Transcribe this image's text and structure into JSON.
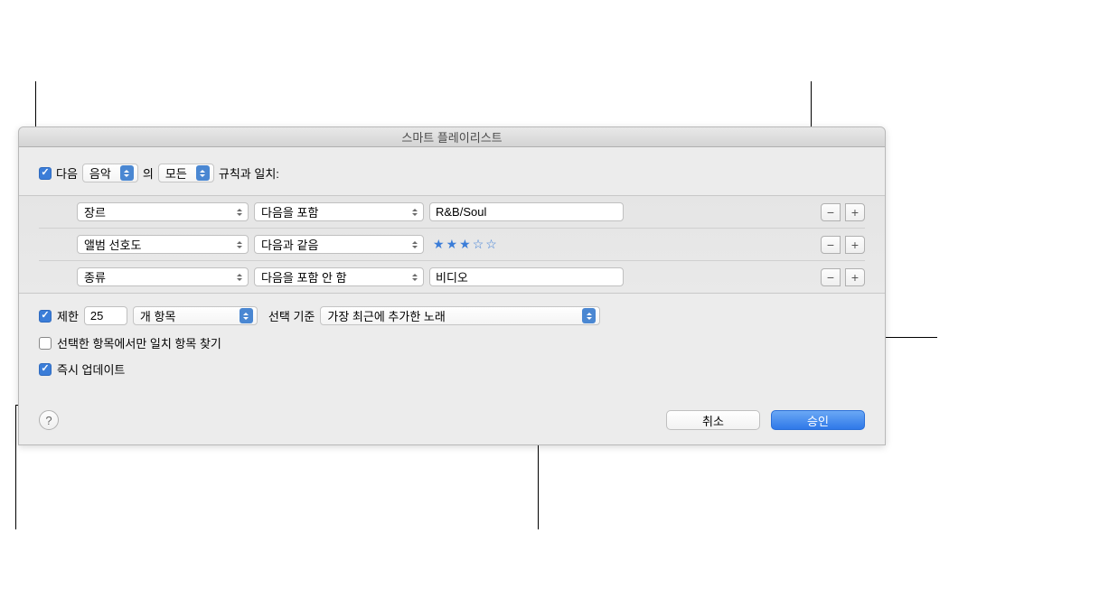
{
  "title": "스마트 플레이리스트",
  "match": {
    "prefix": "다음",
    "media": "음악",
    "joiner": "의",
    "mode": "모든",
    "suffix": "규칙과 일치:"
  },
  "rules": [
    {
      "field": "장르",
      "operator": "다음을 포함",
      "value": "R&B/Soul",
      "type": "text"
    },
    {
      "field": "앨범 선호도",
      "operator": "다음과 같음",
      "value": "3",
      "type": "stars"
    },
    {
      "field": "종류",
      "operator": "다음을 포함 안 함",
      "value": "비디오",
      "type": "text"
    }
  ],
  "limit": {
    "label": "제한",
    "value": "25",
    "unit": "개 항목",
    "select_label": "선택 기준",
    "select_by": "가장 최근에 추가한 노래"
  },
  "only_checked": "선택한 항목에서만 일치 항목 찾기",
  "live_update": "즉시 업데이트",
  "buttons": {
    "cancel": "취소",
    "ok": "승인",
    "help": "?",
    "minus": "−",
    "plus": "+"
  }
}
